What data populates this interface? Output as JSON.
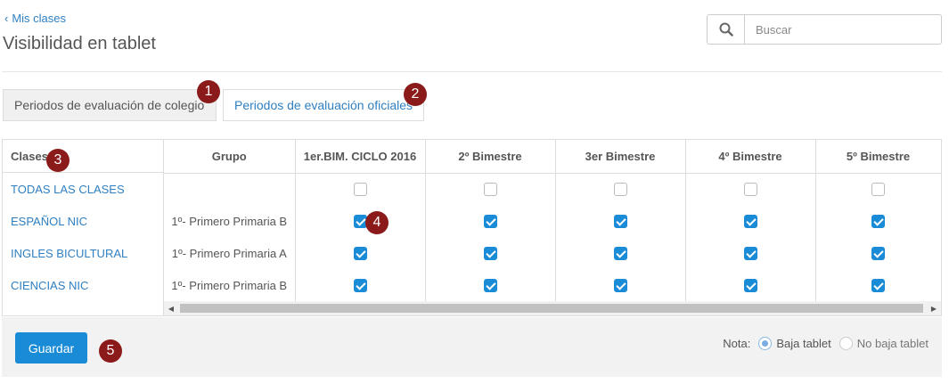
{
  "header": {
    "back_link": "Mis clases",
    "title": "Visibilidad en tablet",
    "search_placeholder": "Buscar"
  },
  "tabs": [
    {
      "label": "Periodos de evaluación de colegio",
      "active": true
    },
    {
      "label": "Periodos de evaluación oficiales",
      "active": false
    }
  ],
  "markers": [
    "1",
    "2",
    "3",
    "4",
    "5"
  ],
  "table": {
    "col_clases": "Clases",
    "col_grupo": "Grupo",
    "periods": [
      "1er.BIM. CICLO 2016",
      "2º Bimestre",
      "3er Bimestre",
      "4º Bimestre",
      "5º Bimestre"
    ],
    "rows": [
      {
        "clase": "TODAS LAS CLASES",
        "grupo": "",
        "checks": [
          false,
          false,
          false,
          false,
          false
        ]
      },
      {
        "clase": "ESPAÑOL NIC",
        "grupo": "1º- Primero Primaria B",
        "checks": [
          true,
          true,
          true,
          true,
          true
        ]
      },
      {
        "clase": "INGLES BICULTURAL",
        "grupo": "1º- Primero Primaria A",
        "checks": [
          true,
          true,
          true,
          true,
          true
        ]
      },
      {
        "clase": "CIENCIAS NIC",
        "grupo": "1º- Primero Primaria B",
        "checks": [
          true,
          true,
          true,
          true,
          true
        ]
      }
    ]
  },
  "footer": {
    "save_label": "Guardar",
    "nota_label": "Nota:",
    "legend": [
      {
        "label": "Baja tablet",
        "selected": true
      },
      {
        "label": "No baja tablet",
        "selected": false
      }
    ]
  },
  "colors": {
    "link": "#2f7fc1",
    "primary": "#1a8bd6",
    "marker": "#8b1a1a"
  }
}
